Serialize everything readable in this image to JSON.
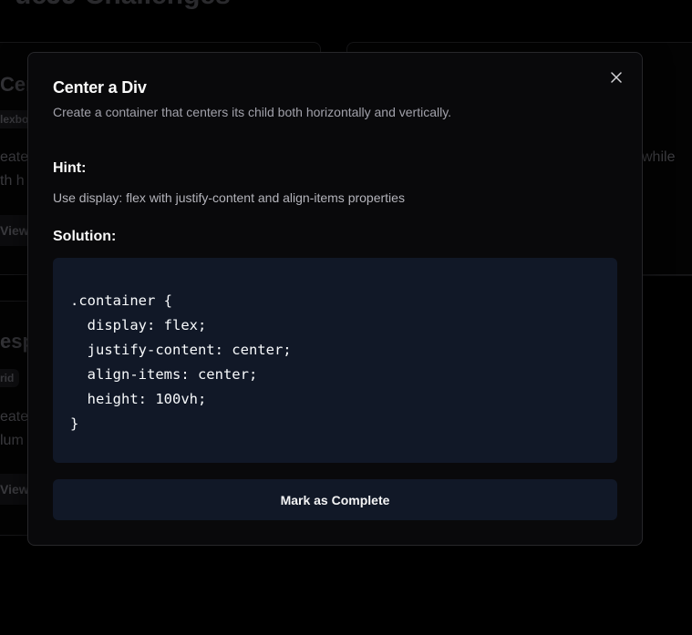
{
  "background": {
    "page_title": "ucJJ Challenges",
    "card1": {
      "title": "Cent",
      "badge": "lexbo",
      "text_lines": [
        "eate",
        "th h"
      ],
      "button_label": "View"
    },
    "card2": {
      "text_right": "while"
    },
    "card3": {
      "title": "esp",
      "badge": "rid",
      "text_lines": [
        "eate",
        "lum"
      ],
      "button_label": "View"
    }
  },
  "modal": {
    "title": "Center a Div",
    "description": "Create a container that centers its child both horizontally and vertically.",
    "hint_heading": "Hint:",
    "hint_text": "Use display: flex with justify-content and align-items properties",
    "solution_heading": "Solution:",
    "code_lines": [
      ".container {",
      "  display: flex;",
      "  justify-content: center;",
      "  align-items: center;",
      "  height: 100vh;",
      "}"
    ],
    "complete_button_label": "Mark as Complete",
    "close_icon": "close-icon"
  },
  "colors": {
    "page_background": "#000000",
    "modal_background": "#09090b",
    "modal_border": "#27272a",
    "code_background": "#111827",
    "button_background": "#111827",
    "muted_text": "#a1a1aa"
  }
}
